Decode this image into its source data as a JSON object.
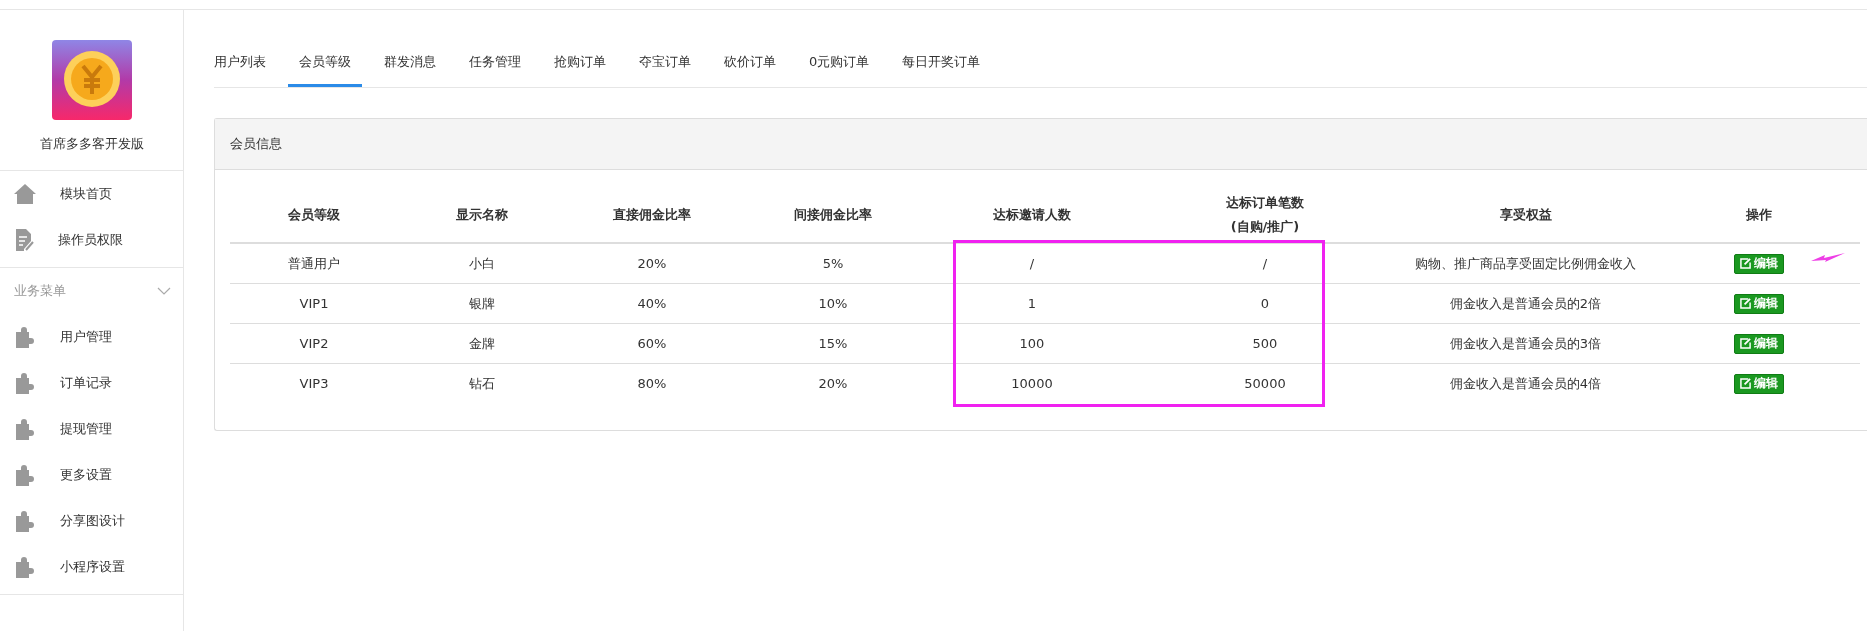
{
  "sidebar": {
    "app_name": "首席多多客开发版",
    "top_items": [
      {
        "label": "模块首页"
      },
      {
        "label": "操作员权限"
      }
    ],
    "section": {
      "title": "业务菜单",
      "expanded": true
    },
    "items": [
      {
        "label": "用户管理"
      },
      {
        "label": "订单记录"
      },
      {
        "label": "提现管理"
      },
      {
        "label": "更多设置"
      },
      {
        "label": "分享图设计"
      },
      {
        "label": "小程序设置"
      }
    ]
  },
  "tabs": [
    {
      "label": "用户列表",
      "selected": false
    },
    {
      "label": "会员等级",
      "selected": true
    },
    {
      "label": "群发消息",
      "selected": false
    },
    {
      "label": "任务管理",
      "selected": false
    },
    {
      "label": "抢购订单",
      "selected": false
    },
    {
      "label": "夺宝订单",
      "selected": false
    },
    {
      "label": "砍价订单",
      "selected": false
    },
    {
      "label": "0元购订单",
      "selected": false
    },
    {
      "label": "每日开奖订单",
      "selected": false
    }
  ],
  "panel": {
    "title": "会员信息",
    "columns": [
      "会员等级",
      "显示名称",
      "直接佣金比率",
      "间接佣金比率",
      "达标邀请人数",
      "达标订单笔数 (自购/推广)",
      "享受权益",
      "操作"
    ],
    "rows": [
      {
        "cells": [
          "普通用户",
          "小白",
          "20%",
          "5%",
          "/",
          "/",
          "购物、推广商品享受固定比例佣金收入"
        ],
        "action": "编辑"
      },
      {
        "cells": [
          "VIP1",
          "银牌",
          "40%",
          "10%",
          "1",
          "0",
          "佣金收入是普通会员的2倍"
        ],
        "action": "编辑"
      },
      {
        "cells": [
          "VIP2",
          "金牌",
          "60%",
          "15%",
          "100",
          "500",
          "佣金收入是普通会员的3倍"
        ],
        "action": "编辑"
      },
      {
        "cells": [
          "VIP3",
          "钻石",
          "80%",
          "20%",
          "10000",
          "50000",
          "佣金收入是普通会员的4倍"
        ],
        "action": "编辑"
      }
    ]
  }
}
